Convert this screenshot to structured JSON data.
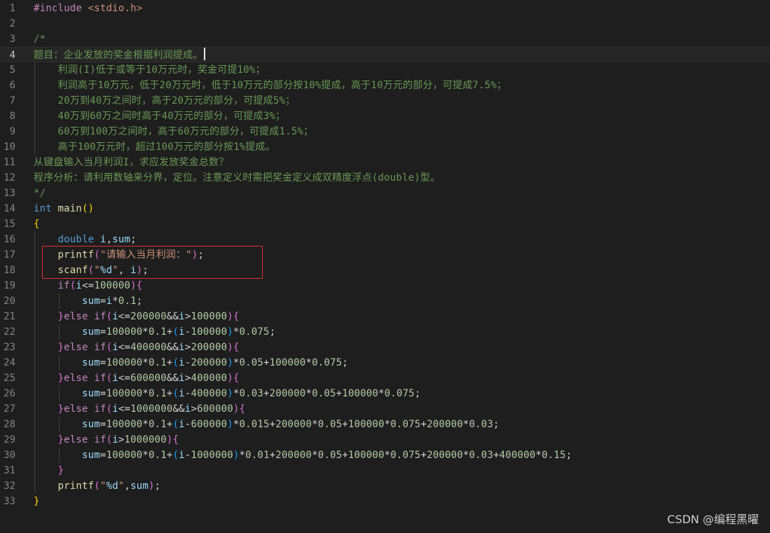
{
  "editor": {
    "lines": [
      {
        "n": "1",
        "tokens": [
          [
            "pp",
            "#include"
          ],
          [
            "op",
            " "
          ],
          [
            "inc",
            "<stdio.h>"
          ]
        ]
      },
      {
        "n": "2",
        "tokens": []
      },
      {
        "n": "3",
        "tokens": [
          [
            "comment",
            "/*"
          ]
        ]
      },
      {
        "n": "4",
        "current": true,
        "tokens": [
          [
            "comment",
            "题目：企业发放的奖金根据利润提成。"
          ]
        ]
      },
      {
        "n": "5",
        "tokens": [
          [
            "comment",
            "    利润(I)低于或等于10万元时，奖金可提10%；"
          ]
        ]
      },
      {
        "n": "6",
        "tokens": [
          [
            "comment",
            "    利润高于10万元，低于20万元时，低于10万元的部分按10%提成，高于10万元的部分，可提成7.5%；"
          ]
        ]
      },
      {
        "n": "7",
        "tokens": [
          [
            "comment",
            "    20万到40万之间时，高于20万元的部分，可提成5%；"
          ]
        ]
      },
      {
        "n": "8",
        "tokens": [
          [
            "comment",
            "    40万到60万之间时高于40万元的部分，可提成3%；"
          ]
        ]
      },
      {
        "n": "9",
        "tokens": [
          [
            "comment",
            "    60万到100万之间时，高于60万元的部分，可提成1.5%；"
          ]
        ]
      },
      {
        "n": "10",
        "tokens": [
          [
            "comment",
            "    高于100万元时，超过100万元的部分按1%提成。"
          ]
        ]
      },
      {
        "n": "11",
        "tokens": [
          [
            "comment",
            "从键盘输入当月利润I，求应发放奖金总数？"
          ]
        ]
      },
      {
        "n": "12",
        "tokens": [
          [
            "comment",
            "程序分析：请利用数轴来分界，定位。注意定义时需把奖金定义成双精度浮点(double)型。"
          ]
        ]
      },
      {
        "n": "13",
        "tokens": [
          [
            "comment",
            "*/"
          ]
        ]
      },
      {
        "n": "14",
        "tokens": [
          [
            "kw",
            "int"
          ],
          [
            "op",
            " "
          ],
          [
            "fn",
            "main"
          ],
          [
            "b1",
            "()"
          ]
        ]
      },
      {
        "n": "15",
        "tokens": [
          [
            "b1",
            "{"
          ]
        ]
      },
      {
        "n": "16",
        "tokens": [
          [
            "op",
            "    "
          ],
          [
            "kw",
            "double"
          ],
          [
            "op",
            " "
          ],
          [
            "var",
            "i"
          ],
          [
            "op",
            ","
          ],
          [
            "var",
            "sum"
          ],
          [
            "op",
            ";"
          ]
        ]
      },
      {
        "n": "17",
        "tokens": [
          [
            "op",
            "    "
          ],
          [
            "fn",
            "printf"
          ],
          [
            "b2",
            "("
          ],
          [
            "str",
            "\"请输入当月利润：\""
          ],
          [
            "b2",
            ")"
          ],
          [
            "op",
            ";"
          ]
        ]
      },
      {
        "n": "18",
        "tokens": [
          [
            "op",
            "    "
          ],
          [
            "fn",
            "scanf"
          ],
          [
            "b2",
            "("
          ],
          [
            "str",
            "\""
          ],
          [
            "fmt",
            "%d"
          ],
          [
            "str",
            "\""
          ],
          [
            "op",
            ", "
          ],
          [
            "var",
            "i"
          ],
          [
            "b2",
            ")"
          ],
          [
            "op",
            ";"
          ]
        ]
      },
      {
        "n": "19",
        "tokens": [
          [
            "op",
            "    "
          ],
          [
            "ctrl",
            "if"
          ],
          [
            "b2",
            "("
          ],
          [
            "var",
            "i"
          ],
          [
            "op",
            "<="
          ],
          [
            "num",
            "100000"
          ],
          [
            "b2",
            ")"
          ],
          [
            "b2",
            "{"
          ]
        ]
      },
      {
        "n": "20",
        "tokens": [
          [
            "op",
            "        "
          ],
          [
            "var",
            "sum"
          ],
          [
            "op",
            "="
          ],
          [
            "var",
            "i"
          ],
          [
            "op",
            "*"
          ],
          [
            "num",
            "0.1"
          ],
          [
            "op",
            ";"
          ]
        ]
      },
      {
        "n": "21",
        "tokens": [
          [
            "op",
            "    "
          ],
          [
            "b2",
            "}"
          ],
          [
            "ctrl",
            "else"
          ],
          [
            "op",
            " "
          ],
          [
            "ctrl",
            "if"
          ],
          [
            "b2",
            "("
          ],
          [
            "var",
            "i"
          ],
          [
            "op",
            "<="
          ],
          [
            "num",
            "200000"
          ],
          [
            "op",
            "&&"
          ],
          [
            "var",
            "i"
          ],
          [
            "op",
            ">"
          ],
          [
            "num",
            "100000"
          ],
          [
            "b2",
            ")"
          ],
          [
            "b2",
            "{"
          ]
        ]
      },
      {
        "n": "22",
        "tokens": [
          [
            "op",
            "        "
          ],
          [
            "var",
            "sum"
          ],
          [
            "op",
            "="
          ],
          [
            "num",
            "100000"
          ],
          [
            "op",
            "*"
          ],
          [
            "num",
            "0.1"
          ],
          [
            "op",
            "+"
          ],
          [
            "b3",
            "("
          ],
          [
            "var",
            "i"
          ],
          [
            "op",
            "-"
          ],
          [
            "num",
            "100000"
          ],
          [
            "b3",
            ")"
          ],
          [
            "op",
            "*"
          ],
          [
            "num",
            "0.075"
          ],
          [
            "op",
            ";"
          ]
        ]
      },
      {
        "n": "23",
        "tokens": [
          [
            "op",
            "    "
          ],
          [
            "b2",
            "}"
          ],
          [
            "ctrl",
            "else"
          ],
          [
            "op",
            " "
          ],
          [
            "ctrl",
            "if"
          ],
          [
            "b2",
            "("
          ],
          [
            "var",
            "i"
          ],
          [
            "op",
            "<="
          ],
          [
            "num",
            "400000"
          ],
          [
            "op",
            "&&"
          ],
          [
            "var",
            "i"
          ],
          [
            "op",
            ">"
          ],
          [
            "num",
            "200000"
          ],
          [
            "b2",
            ")"
          ],
          [
            "b2",
            "{"
          ]
        ]
      },
      {
        "n": "24",
        "tokens": [
          [
            "op",
            "        "
          ],
          [
            "var",
            "sum"
          ],
          [
            "op",
            "="
          ],
          [
            "num",
            "100000"
          ],
          [
            "op",
            "*"
          ],
          [
            "num",
            "0.1"
          ],
          [
            "op",
            "+"
          ],
          [
            "b3",
            "("
          ],
          [
            "var",
            "i"
          ],
          [
            "op",
            "-"
          ],
          [
            "num",
            "200000"
          ],
          [
            "b3",
            ")"
          ],
          [
            "op",
            "*"
          ],
          [
            "num",
            "0.05"
          ],
          [
            "op",
            "+"
          ],
          [
            "num",
            "100000"
          ],
          [
            "op",
            "*"
          ],
          [
            "num",
            "0.075"
          ],
          [
            "op",
            ";"
          ]
        ]
      },
      {
        "n": "25",
        "tokens": [
          [
            "op",
            "    "
          ],
          [
            "b2",
            "}"
          ],
          [
            "ctrl",
            "else"
          ],
          [
            "op",
            " "
          ],
          [
            "ctrl",
            "if"
          ],
          [
            "b2",
            "("
          ],
          [
            "var",
            "i"
          ],
          [
            "op",
            "<="
          ],
          [
            "num",
            "600000"
          ],
          [
            "op",
            "&&"
          ],
          [
            "var",
            "i"
          ],
          [
            "op",
            ">"
          ],
          [
            "num",
            "400000"
          ],
          [
            "b2",
            ")"
          ],
          [
            "b2",
            "{"
          ]
        ]
      },
      {
        "n": "26",
        "tokens": [
          [
            "op",
            "        "
          ],
          [
            "var",
            "sum"
          ],
          [
            "op",
            "="
          ],
          [
            "num",
            "100000"
          ],
          [
            "op",
            "*"
          ],
          [
            "num",
            "0.1"
          ],
          [
            "op",
            "+"
          ],
          [
            "b3",
            "("
          ],
          [
            "var",
            "i"
          ],
          [
            "op",
            "-"
          ],
          [
            "num",
            "400000"
          ],
          [
            "b3",
            ")"
          ],
          [
            "op",
            "*"
          ],
          [
            "num",
            "0.03"
          ],
          [
            "op",
            "+"
          ],
          [
            "num",
            "200000"
          ],
          [
            "op",
            "*"
          ],
          [
            "num",
            "0.05"
          ],
          [
            "op",
            "+"
          ],
          [
            "num",
            "100000"
          ],
          [
            "op",
            "*"
          ],
          [
            "num",
            "0.075"
          ],
          [
            "op",
            ";"
          ]
        ]
      },
      {
        "n": "27",
        "tokens": [
          [
            "op",
            "    "
          ],
          [
            "b2",
            "}"
          ],
          [
            "ctrl",
            "else"
          ],
          [
            "op",
            " "
          ],
          [
            "ctrl",
            "if"
          ],
          [
            "b2",
            "("
          ],
          [
            "var",
            "i"
          ],
          [
            "op",
            "<="
          ],
          [
            "num",
            "1000000"
          ],
          [
            "op",
            "&&"
          ],
          [
            "var",
            "i"
          ],
          [
            "op",
            ">"
          ],
          [
            "num",
            "600000"
          ],
          [
            "b2",
            ")"
          ],
          [
            "b2",
            "{"
          ]
        ]
      },
      {
        "n": "28",
        "tokens": [
          [
            "op",
            "        "
          ],
          [
            "var",
            "sum"
          ],
          [
            "op",
            "="
          ],
          [
            "num",
            "100000"
          ],
          [
            "op",
            "*"
          ],
          [
            "num",
            "0.1"
          ],
          [
            "op",
            "+"
          ],
          [
            "b3",
            "("
          ],
          [
            "var",
            "i"
          ],
          [
            "op",
            "-"
          ],
          [
            "num",
            "600000"
          ],
          [
            "b3",
            ")"
          ],
          [
            "op",
            "*"
          ],
          [
            "num",
            "0.015"
          ],
          [
            "op",
            "+"
          ],
          [
            "num",
            "200000"
          ],
          [
            "op",
            "*"
          ],
          [
            "num",
            "0.05"
          ],
          [
            "op",
            "+"
          ],
          [
            "num",
            "100000"
          ],
          [
            "op",
            "*"
          ],
          [
            "num",
            "0.075"
          ],
          [
            "op",
            "+"
          ],
          [
            "num",
            "200000"
          ],
          [
            "op",
            "*"
          ],
          [
            "num",
            "0.03"
          ],
          [
            "op",
            ";"
          ]
        ]
      },
      {
        "n": "29",
        "tokens": [
          [
            "op",
            "    "
          ],
          [
            "b2",
            "}"
          ],
          [
            "ctrl",
            "else"
          ],
          [
            "op",
            " "
          ],
          [
            "ctrl",
            "if"
          ],
          [
            "b2",
            "("
          ],
          [
            "var",
            "i"
          ],
          [
            "op",
            ">"
          ],
          [
            "num",
            "1000000"
          ],
          [
            "b2",
            ")"
          ],
          [
            "b2",
            "{"
          ]
        ]
      },
      {
        "n": "30",
        "tokens": [
          [
            "op",
            "        "
          ],
          [
            "var",
            "sum"
          ],
          [
            "op",
            "="
          ],
          [
            "num",
            "100000"
          ],
          [
            "op",
            "*"
          ],
          [
            "num",
            "0.1"
          ],
          [
            "op",
            "+"
          ],
          [
            "b3",
            "("
          ],
          [
            "var",
            "i"
          ],
          [
            "op",
            "-"
          ],
          [
            "num",
            "1000000"
          ],
          [
            "b3",
            ")"
          ],
          [
            "op",
            "*"
          ],
          [
            "num",
            "0.01"
          ],
          [
            "op",
            "+"
          ],
          [
            "num",
            "200000"
          ],
          [
            "op",
            "*"
          ],
          [
            "num",
            "0.05"
          ],
          [
            "op",
            "+"
          ],
          [
            "num",
            "100000"
          ],
          [
            "op",
            "*"
          ],
          [
            "num",
            "0.075"
          ],
          [
            "op",
            "+"
          ],
          [
            "num",
            "200000"
          ],
          [
            "op",
            "*"
          ],
          [
            "num",
            "0.03"
          ],
          [
            "op",
            "+"
          ],
          [
            "num",
            "400000"
          ],
          [
            "op",
            "*"
          ],
          [
            "num",
            "0.15"
          ],
          [
            "op",
            ";"
          ]
        ]
      },
      {
        "n": "31",
        "tokens": [
          [
            "op",
            "    "
          ],
          [
            "b2",
            "}"
          ]
        ]
      },
      {
        "n": "32",
        "tokens": [
          [
            "op",
            "    "
          ],
          [
            "fn",
            "printf"
          ],
          [
            "b2",
            "("
          ],
          [
            "str",
            "\""
          ],
          [
            "fmt",
            "%d"
          ],
          [
            "str",
            "\""
          ],
          [
            "op",
            ","
          ],
          [
            "var",
            "sum"
          ],
          [
            "b2",
            ")"
          ],
          [
            "op",
            ";"
          ]
        ]
      },
      {
        "n": "33",
        "tokens": [
          [
            "b1",
            "}"
          ]
        ]
      }
    ]
  },
  "annotation": {
    "highlight_color": "#e03030"
  },
  "watermark": {
    "text": "CSDN @编程黑曜"
  }
}
